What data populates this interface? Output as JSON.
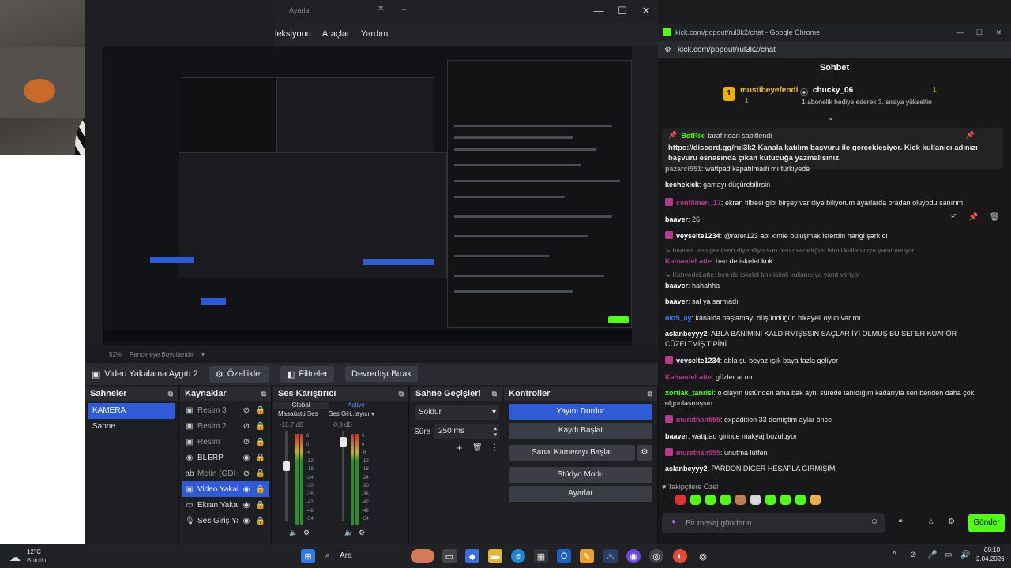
{
  "obs": {
    "window_title": "Ayarlar",
    "menu": [
      "leksiyonu",
      "Araçlar",
      "Yardım"
    ],
    "preview_footer": {
      "zoom": "52%",
      "fit": "Pencereye Boyutlandır"
    },
    "source_toolbar": {
      "source_name": "Video Yakalama Aygıtı 2",
      "properties": "Özellikler",
      "filters": "Filtreler",
      "deactivate": "Devredışı Bırak"
    },
    "scenes": {
      "title": "Sahneler",
      "items": [
        "KAMERA",
        "Sahne"
      ]
    },
    "sources": {
      "title": "Kaynaklar",
      "items": [
        {
          "name": "Resim 3",
          "icon": "image-icon",
          "visible": false
        },
        {
          "name": "Resim 2",
          "icon": "image-icon",
          "visible": false
        },
        {
          "name": "Resim",
          "icon": "image-icon",
          "visible": false
        },
        {
          "name": "BLERP",
          "icon": "globe-icon",
          "visible": true
        },
        {
          "name": "Metin (GDI+",
          "icon": "text-icon",
          "visible": false
        },
        {
          "name": "Video Yakal:",
          "icon": "camera-icon",
          "visible": true
        },
        {
          "name": "Ekran Yakal:",
          "icon": "monitor-icon",
          "visible": true
        },
        {
          "name": "Ses Giriş Yak",
          "icon": "mic-icon",
          "visible": true
        }
      ]
    },
    "mixer": {
      "title": "Ses Karıştırıcı",
      "global_tab": "Global",
      "active_tab": "Active",
      "channels": [
        {
          "name": "Masaüstü Ses",
          "db": "-10.7 dB"
        },
        {
          "name": "Ses Giri..layıcı",
          "db": "-0.8 dB"
        }
      ],
      "scale": [
        "6",
        "0",
        "-6",
        "-12",
        "-18",
        "-24",
        "-30",
        "-36",
        "-42",
        "-48",
        "-54"
      ]
    },
    "transitions": {
      "title": "Sahne Geçişleri",
      "type": "Soldur",
      "duration_label": "Süre",
      "duration_value": "250 ms"
    },
    "controls": {
      "title": "Kontroller",
      "buttons": [
        "Yayını Durdur",
        "Kaydı Başlat",
        "Sanal Kamerayı Başlat",
        "Stüdyo Modu",
        "Ayarlar"
      ]
    }
  },
  "chrome": {
    "title": "kick.com/popout/rul3k2/chat - Google Chrome",
    "address": "kick.com/popout/rul3k2/chat",
    "chat_title": "Sohbet",
    "gift": {
      "rank": "1",
      "gifter": "mustibeyefendi",
      "gifter_count": "1",
      "receiver": "chucky_06",
      "receiver_count": "1",
      "text": "1 abonelik hediye ederek 3. sıraya yükseltin"
    },
    "pinned": {
      "by_user": "BotRix",
      "by_text": "tarafından sabitlendi",
      "link": "https://discord.gg/rul3k2",
      "body": "Kanala katılım başvuru ile gerçekleşiyor. Kick kullanıcı adınızı başvuru esnasında çıkan kutucuğa yazmalısınız."
    },
    "messages": [
      {
        "user": "pazarci551",
        "text": "wattpad kapatılmadı mı türkiyede",
        "color": "#9e9e9e",
        "badge": false
      },
      {
        "user": "kechekick",
        "text": "gamayı düşürebilirsin",
        "color": "#ffffff",
        "badge": false
      },
      {
        "user": "centilmen_17",
        "text": "ekran filtresi gibi birşey var diye biliyorum ayarlarda oradan oluyodu sanırım",
        "color": "#b23b8c",
        "badge": true
      },
      {
        "user": "baaver",
        "text": "26",
        "color": "#ffffff",
        "badge": false
      },
      {
        "user": "veyselte1234",
        "text": "@rarer123 abi kimle buluşmak isterdin hangi şarkıcı",
        "color": "#ffffff",
        "badge": true
      },
      {
        "reply": "baaver: sen gençsen diyebiliyorsan ben mezarlığım isimli kullanıcıya yanıt veriyor"
      },
      {
        "user": "KahvedeLatte",
        "text": "ben de iskelet knk",
        "color": "#b23b8c",
        "badge": false
      },
      {
        "reply": "KahvedeLatte: ben de iskelet knk isimli kullanıcıya yanıt veriyor"
      },
      {
        "user": "baaver",
        "text": "hahahha",
        "color": "#ffffff",
        "badge": false
      },
      {
        "user": "baaver",
        "text": "sal ya sarmadı",
        "color": "#ffffff",
        "badge": false
      },
      {
        "user": "okt5_ay",
        "text": "kanalda başlamayı düşündüğün hikayeli oyun var mı",
        "color": "#3b82f6",
        "badge": false
      },
      {
        "user": "aslanbeyyy2",
        "text": "ABLA BANIMINI KALDIRMIŞSSIN SAÇLAR İYİ OLMUŞ BU SEFER KUAFÖR CÜZELTMİŞ TİPİNİ",
        "color": "#ffffff",
        "badge": false
      },
      {
        "user": "veyselte1234",
        "text": "abla şu beyaz ışık baya fazla geliyor",
        "color": "#ffffff",
        "badge": true
      },
      {
        "user": "KahvedeLatte",
        "text": "gözler ai mı",
        "color": "#b23b8c",
        "badge": false
      },
      {
        "user": "xortlak_tanrisi",
        "text": "o olayın üstünden ama bak ayni sürede tanıdığım kadarıyla sen benden daha çok olgunlaşmışsın",
        "color": "#53fc18",
        "badge": false
      },
      {
        "user": "murathan555",
        "text": "expadition 33 demiştim aylar önce",
        "color": "#b23b8c",
        "badge": true
      },
      {
        "user": "baaver",
        "text": "wattpad girince makyaj bozuluyor",
        "color": "#ffffff",
        "badge": false
      },
      {
        "user": "murathan555",
        "text": "unutma lütfen",
        "color": "#b23b8c",
        "badge": true
      },
      {
        "user": "aslanbeyyy2",
        "text": "PARDON DİGER HESAPLA GİRMİŞİM",
        "color": "#ffffff",
        "badge": false
      }
    ],
    "emote_section": "Takipçilere Özel",
    "input_placeholder": "Bir mesaj gönderin",
    "send": "Gönder"
  },
  "taskbar": {
    "weather_temp": "12°C",
    "weather_desc": "Bulutlu",
    "search": "Ara",
    "time": "00:10",
    "date": "2.04.2026"
  },
  "colors": {
    "obs_blue": "#2f5bd6",
    "kick_green": "#53fc18"
  }
}
